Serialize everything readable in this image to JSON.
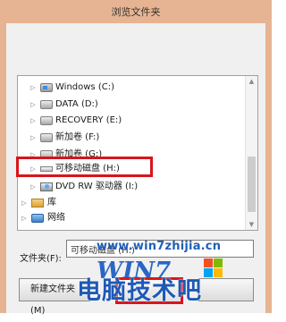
{
  "dialog": {
    "title": "浏览文件夹"
  },
  "tree": {
    "items": [
      {
        "label": "Windows (C:)",
        "icon": "windows-drive-icon",
        "indent": 1
      },
      {
        "label": "DATA (D:)",
        "icon": "hard-drive-icon",
        "indent": 1
      },
      {
        "label": "RECOVERY (E:)",
        "icon": "hard-drive-icon",
        "indent": 1
      },
      {
        "label": "新加卷 (F:)",
        "icon": "hard-drive-icon",
        "indent": 1
      },
      {
        "label": "新加卷 (G:)",
        "icon": "hard-drive-icon",
        "indent": 1
      },
      {
        "label": "可移动磁盘 (H:)",
        "icon": "usb-drive-icon",
        "indent": 1,
        "highlighted": true
      },
      {
        "label": "DVD RW 驱动器 (I:)",
        "icon": "dvd-drive-icon",
        "indent": 1
      },
      {
        "label": "库",
        "icon": "library-icon",
        "indent": 0
      },
      {
        "label": "网络",
        "icon": "network-icon",
        "indent": 0
      }
    ]
  },
  "folder_field": {
    "label": "文件夹(F):",
    "value": "可移动磁盘 (H:)"
  },
  "buttons": {
    "new_folder": "新建文件夹(M)",
    "ok": "",
    "cancel": ""
  },
  "watermark": {
    "url": "www.win7zhijia.cn",
    "logo": "WIN7",
    "text": "电脑技术吧"
  },
  "colors": {
    "frame": "#e6b492",
    "highlight": "#d8151c",
    "watermark": "#1e59b5"
  }
}
